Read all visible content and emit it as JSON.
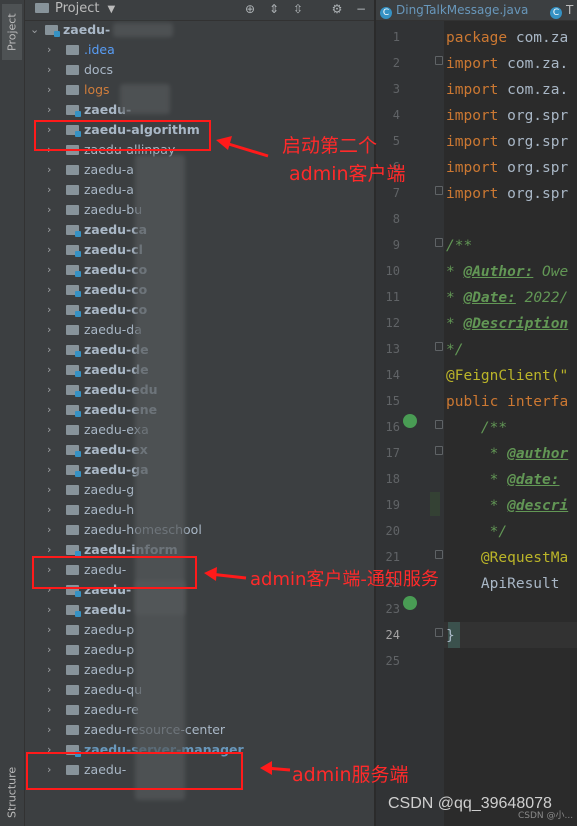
{
  "toolstrip": {
    "project_tab": "Project",
    "structure_tab": "Structure"
  },
  "project_panel": {
    "title": "Project",
    "root": "zaedu-",
    "items": [
      {
        "label": ".idea",
        "color": "blue"
      },
      {
        "label": "docs"
      },
      {
        "label": "logs",
        "color": "orange"
      },
      {
        "label": "zaedu-",
        "bold": true,
        "module": true
      },
      {
        "label": "zaedu-algorithm",
        "bold": true,
        "module": true
      },
      {
        "label": "zaedu-allinpay"
      },
      {
        "label": "zaedu-a"
      },
      {
        "label": "zaedu-a"
      },
      {
        "label": "zaedu-bu"
      },
      {
        "label": "zaedu-ca",
        "bold": true,
        "module": true
      },
      {
        "label": "zaedu-cl",
        "bold": true,
        "module": true
      },
      {
        "label": "zaedu-co",
        "bold": true,
        "module": true
      },
      {
        "label": "zaedu-co",
        "bold": true,
        "module": true
      },
      {
        "label": "zaedu-co",
        "bold": true,
        "module": true
      },
      {
        "label": "zaedu-da"
      },
      {
        "label": "zaedu-de",
        "bold": true,
        "module": true
      },
      {
        "label": "zaedu-de",
        "bold": true,
        "module": true
      },
      {
        "label": "zaedu-edu",
        "bold": true,
        "module": true
      },
      {
        "label": "zaedu-ene",
        "bold": true,
        "module": true
      },
      {
        "label": "zaedu-exa"
      },
      {
        "label": "zaedu-ex",
        "bold": true,
        "module": true
      },
      {
        "label": "zaedu-ga",
        "bold": true,
        "module": true
      },
      {
        "label": "zaedu-g"
      },
      {
        "label": "zaedu-h"
      },
      {
        "label": "zaedu-homeschool"
      },
      {
        "label": "zaedu-inform",
        "bold": true,
        "module": true
      },
      {
        "label": "zaedu-"
      },
      {
        "label": "zaedu-",
        "bold": true,
        "module": true
      },
      {
        "label": "zaedu-",
        "bold": true,
        "module": true
      },
      {
        "label": "zaedu-p"
      },
      {
        "label": "zaedu-p"
      },
      {
        "label": "zaedu-p"
      },
      {
        "label": "zaedu-qu"
      },
      {
        "label": "zaedu-re"
      },
      {
        "label": "zaedu-resource-center"
      },
      {
        "label": "zaedu-server-manager",
        "bold": true,
        "module": true,
        "color": "selected"
      },
      {
        "label": "zaedu-"
      }
    ]
  },
  "editor": {
    "tabs": [
      {
        "label": "DingTalkMessage.java"
      },
      {
        "label": "T"
      }
    ],
    "lines": [
      "1",
      "2",
      "3",
      "4",
      "5",
      "6",
      "7",
      "8",
      "9",
      "10",
      "11",
      "12",
      "13",
      "14",
      "15",
      "16",
      "17",
      "18",
      "19",
      "20",
      "21",
      "22",
      "23",
      "24",
      "25"
    ],
    "code": {
      "l1": [
        "package",
        " com.za"
      ],
      "l2": [
        "import",
        " com.za."
      ],
      "l3": [
        "import",
        " com.za."
      ],
      "l4": [
        "import",
        " org.spr"
      ],
      "l5": [
        "import",
        " org.spr"
      ],
      "l6": [
        "import",
        " org.spr"
      ],
      "l7": [
        "import",
        " org.spr"
      ],
      "l9": "/**",
      "l10": [
        "* ",
        "@Author:",
        " Owe"
      ],
      "l11": [
        "* ",
        "@Date:",
        " 2022/"
      ],
      "l12": [
        "* ",
        "@Description"
      ],
      "l13": "*/",
      "l14": "@FeignClient(\"",
      "l15": [
        "public",
        " interfa"
      ],
      "l16": "    /**",
      "l17": [
        "     * ",
        "@author"
      ],
      "l18": [
        "     * ",
        "@date:"
      ],
      "l19": [
        "     * ",
        "@descri"
      ],
      "l20": "     */",
      "l21": "    @RequestMa",
      "l22": "    ApiResult",
      "l24": "}"
    }
  },
  "annotations": {
    "algorithm": [
      "启动第二个",
      "admin客户端"
    ],
    "inform": "admin客户端-通知服务",
    "server": "admin服务端"
  },
  "watermark": "CSDN @qq_39648078",
  "watermark_small": "CSDN @小...",
  "colors": {
    "accent_red": "#ff1a1a",
    "selected_blue": "#6897bb",
    "keyword": "#cc7832",
    "javadoc": "#629755"
  }
}
